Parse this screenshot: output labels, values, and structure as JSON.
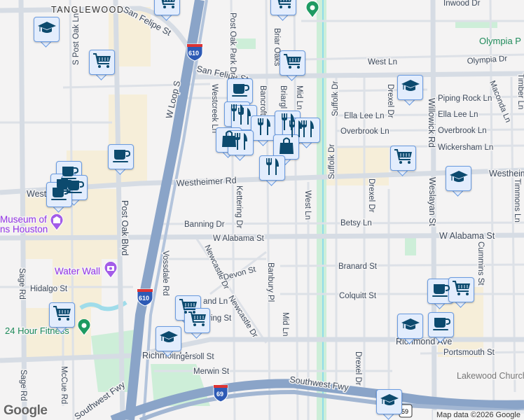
{
  "map": {
    "streets": [
      "TANGLEWOOD",
      "San Felipe St",
      "San Felipe St",
      "Post Oak Park Dr",
      "Westcreek Ln",
      "Briar Oaks",
      "Bancroft Ln",
      "Briargl",
      "Mid Ln",
      "S Post Oak Ln",
      "W Loop S",
      "Westheimer Rd",
      "Westheimer Rd",
      "West",
      "Post Oak Blvd",
      "Kettering Dr",
      "Banning Dr",
      "W Alabama St",
      "W Alabama St",
      "West Ln",
      "Suffolk Dr",
      "Suffolk Dr",
      "Drexel Dr",
      "Drexel Dr",
      "Betsy Ln",
      "Inwood Dr",
      "West Ln",
      "Olympia Dr",
      "Piping Rock Ln",
      "Ella Lee Ln",
      "Ella Lee Ln",
      "Overbrook Ln",
      "Overbrook Ln",
      "Wickersham Ln",
      "Willowick Rd",
      "Weslayan St",
      "Maconda Ln",
      "Timber Ln",
      "Timmons Ln",
      "Cummins St",
      "Vossdale Rd",
      "Newcastle Dr",
      "Newcastle Dr",
      "Devon St",
      "Banbury Pl",
      "Mid Ln",
      "Branard St",
      "Colquitt St",
      "Hidalgo St",
      "Sage Rd",
      "Sage Rd",
      "McCue Rd",
      "Richmond Ave",
      "Richmond Ave",
      "Ingersoll St",
      "Merwin St",
      "Portsmouth St",
      "Southwest Fwy",
      "Southwest Fwy",
      "Drexel Dr",
      "Lakewood Church",
      "and Ln",
      "ring St"
    ],
    "pois": {
      "museum": "Museum of",
      "museum2": "ns Houston",
      "water_wall": "Water Wall",
      "fitness": "24 Hour Fitness",
      "park": "Olympia P"
    },
    "shields": [
      "610",
      "610",
      "69",
      "59"
    ],
    "markers": [
      "school",
      "cart",
      "cart",
      "cart",
      "coffee",
      "coffee",
      "coffee",
      "coffee",
      "coffee",
      "cart",
      "coffee",
      "restaurant",
      "restaurant",
      "restaurant",
      "shopping",
      "restaurant",
      "restaurant",
      "restaurant",
      "restaurant",
      "shopping",
      "restaurant",
      "school",
      "cart",
      "school",
      "cart",
      "cart",
      "school",
      "cart",
      "coffee",
      "cart",
      "school",
      "coffee",
      "school"
    ],
    "attribution": "Map data ©2026 Google",
    "logo": "Google"
  },
  "colors": {
    "highway": "#8aa4c8",
    "road": "#d6dce4",
    "commercial": "#f6eed9",
    "park": "#cdeed8",
    "marker_fill": "#e3edfd",
    "marker_icon": "#0c4a6e"
  }
}
